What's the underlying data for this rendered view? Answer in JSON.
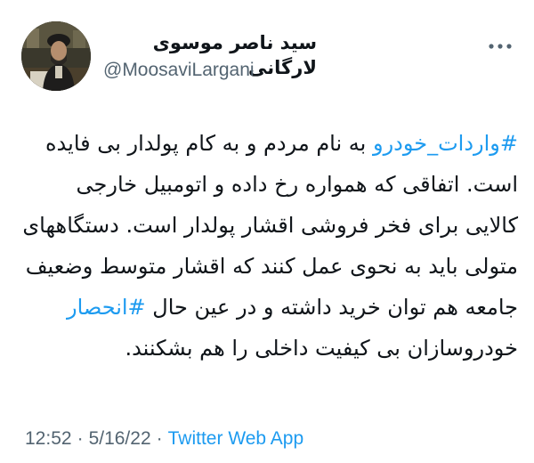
{
  "author": {
    "name": "سید ناصر موسوی لارگانی",
    "handle": "@MoosaviLargani"
  },
  "tweet": {
    "hashtag_1": "#واردات_خودرو",
    "part_1": " به نام مردم و به کام پولدار بی فایده است. اتفاقی که همواره رخ داده و اتومبیل خارجی کالایی برای فخر فروشی اقشار پولدار است. دستگاههای متولی باید به نحوی عمل کنند که اقشار متوسط وضعیف جامعه هم توان خرید داشته و در عین حال ",
    "hashtag_2": "#انحصار",
    "part_2": " خودروسازان بی کیفیت داخلی را هم بشکنند."
  },
  "meta": {
    "time": "12:52",
    "separator": "·",
    "date": "5/16/22",
    "source": "Twitter Web App"
  },
  "icons": {
    "more": "more-horizontal-icon"
  },
  "colors": {
    "link": "#1d9bf0",
    "text": "#0f1419",
    "secondary": "#536471",
    "background": "#ffffff"
  }
}
